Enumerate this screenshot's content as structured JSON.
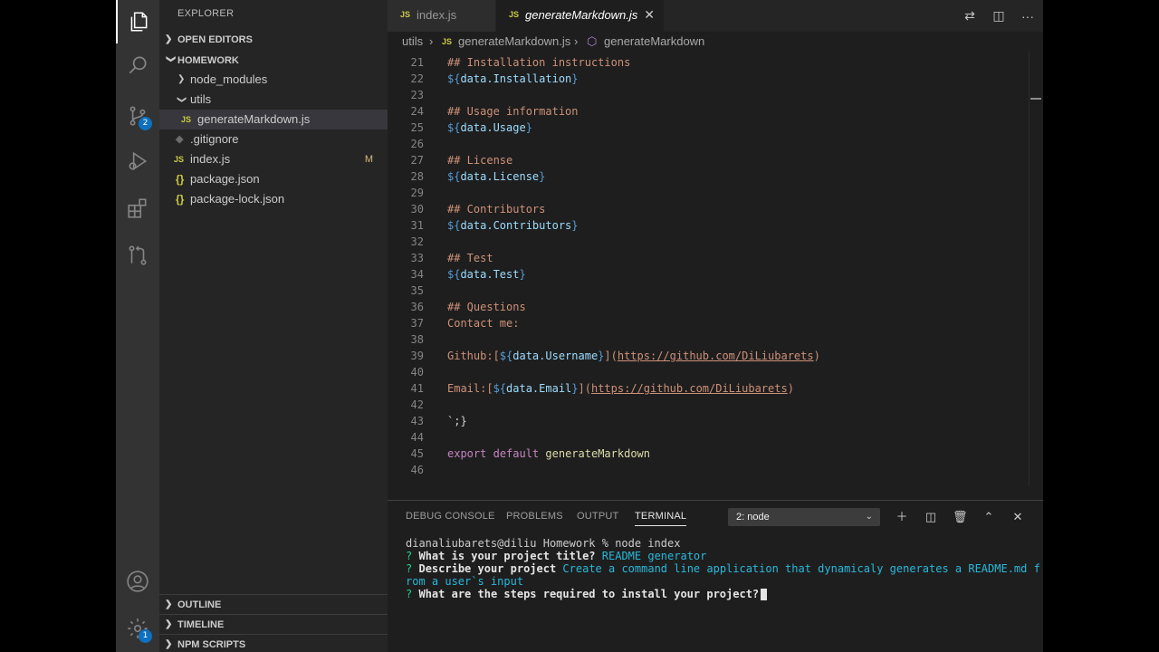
{
  "activity": {
    "icons": [
      "files-icon",
      "search-icon",
      "source-control-icon",
      "run-debug-icon",
      "extensions-icon",
      "remote-icon",
      "account-icon",
      "settings-gear-icon"
    ],
    "source_control_badge": "2",
    "settings_badge": "1"
  },
  "sidebar": {
    "title": "EXPLORER",
    "open_editors": "OPEN EDITORS",
    "folder": "HOMEWORK",
    "tree": [
      {
        "name": "node_modules",
        "type": "folder"
      },
      {
        "name": "utils",
        "type": "folder"
      },
      {
        "name": "generateMarkdown.js",
        "type": "js"
      },
      {
        "name": ".gitignore",
        "type": "git"
      },
      {
        "name": "index.js",
        "type": "js",
        "status": "M"
      },
      {
        "name": "package.json",
        "type": "json"
      },
      {
        "name": "package-lock.json",
        "type": "json"
      }
    ],
    "outline": "OUTLINE",
    "timeline": "TIMELINE",
    "npm_scripts": "NPM SCRIPTS"
  },
  "tabs": [
    {
      "label": "index.js",
      "icon": "JS"
    },
    {
      "label": "generateMarkdown.js",
      "icon": "JS"
    }
  ],
  "breadcrumb": {
    "folder": "utils",
    "file": "generateMarkdown.js",
    "symbol": "generateMarkdown"
  },
  "code": {
    "line_numbers": [
      "21",
      "22",
      "23",
      "24",
      "25",
      "26",
      "27",
      "28",
      "29",
      "30",
      "31",
      "32",
      "33",
      "34",
      "35",
      "36",
      "37",
      "38",
      "39",
      "40",
      "41",
      "42",
      "43",
      "44",
      "45",
      "46"
    ],
    "l21": "## Installation instructions",
    "l22_var": "data.Installation",
    "l24": "## Usage information",
    "l25_var": "data.Usage",
    "l27": "## License",
    "l28_var": "data.License",
    "l30": "## Contributors",
    "l31_var": "data.Contributors",
    "l33": "## Test",
    "l34_var": "data.Test",
    "l36": "## Questions",
    "l37": "Contact me:",
    "l39_prefix": "Github:[",
    "l39_var": "data.Username",
    "l39_url": "https://github.com/DiLiubarets",
    "l41_prefix": "Email:[",
    "l41_var": "data.Email",
    "l41_url": "https://github.com/DiLiubarets",
    "l43": "`;}",
    "l45_kw1": "export",
    "l45_kw2": "default",
    "l45_fn": "generateMarkdown",
    "interp_open": "${",
    "interp_close": "}",
    "link_mid": "](",
    "link_close": ")"
  },
  "panel": {
    "tabs": [
      "DEBUG CONSOLE",
      "PROBLEMS",
      "OUTPUT",
      "TERMINAL"
    ],
    "terminal_select": "2: node",
    "terminal": {
      "prompt_line": "dianaliubarets@diliu Homework % node index",
      "q_mark": "?",
      "q1": "What is your project title?",
      "a1": "README generator",
      "q2": "Describe your project",
      "a2_line1": "Create a command line application that dynamicaly generates a README.md f",
      "a2_line2": "rom a user`s input",
      "q3": "What are the steps required to install your project?"
    }
  }
}
